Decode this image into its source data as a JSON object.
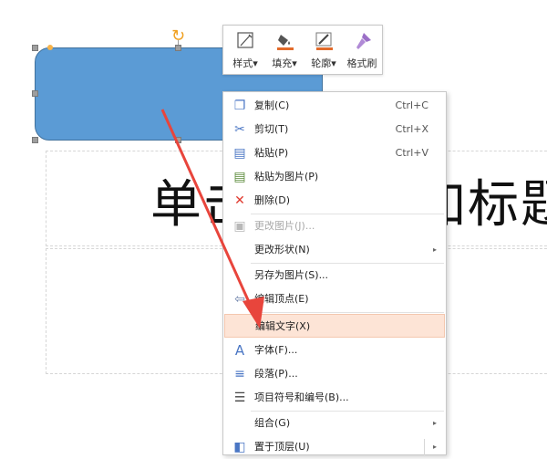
{
  "slide": {
    "title": "单击此处添加标题",
    "title_visible": "单击                 加标题",
    "subtitle_fragment": "题"
  },
  "mini_toolbar": {
    "items": [
      {
        "label": "样式",
        "icon": "shape-style-icon"
      },
      {
        "label": "填充",
        "icon": "fill-bucket-icon"
      },
      {
        "label": "轮廓",
        "icon": "outline-pen-icon"
      },
      {
        "label": "格式刷",
        "icon": "format-brush-icon"
      }
    ],
    "dropdown_glyph": "▾"
  },
  "context_menu": {
    "items": [
      {
        "label": "复制(C)",
        "shortcut": "Ctrl+C",
        "icon": "copy-icon"
      },
      {
        "label": "剪切(T)",
        "shortcut": "Ctrl+X",
        "icon": "cut-icon"
      },
      {
        "label": "粘贴(P)",
        "shortcut": "Ctrl+V",
        "icon": "paste-icon"
      },
      {
        "label": "粘贴为图片(P)",
        "shortcut": "",
        "icon": "paste-as-picture-icon"
      },
      {
        "label": "删除(D)",
        "shortcut": "",
        "icon": "delete-icon"
      },
      {
        "label": "更改图片(J)...",
        "shortcut": "",
        "icon": "change-picture-icon",
        "disabled": true
      },
      {
        "label": "更改形状(N)",
        "shortcut": "",
        "icon": "",
        "submenu": true
      },
      {
        "label": "另存为图片(S)...",
        "shortcut": "",
        "icon": ""
      },
      {
        "label": "编辑顶点(E)",
        "shortcut": "",
        "icon": "edit-points-icon"
      },
      {
        "label": "编辑文字(X)",
        "shortcut": "",
        "icon": "",
        "highlighted": true
      },
      {
        "label": "字体(F)...",
        "shortcut": "",
        "icon": "font-icon"
      },
      {
        "label": "段落(P)...",
        "shortcut": "",
        "icon": "paragraph-icon"
      },
      {
        "label": "项目符号和编号(B)...",
        "shortcut": "",
        "icon": "bullets-icon"
      },
      {
        "label": "组合(G)",
        "shortcut": "",
        "icon": "",
        "submenu": true
      },
      {
        "label": "置于顶层(U)",
        "shortcut": "",
        "icon": "bring-to-front-icon",
        "submenu_split": true
      }
    ],
    "submenu_arrow": "▸"
  },
  "colors": {
    "shape_fill": "#5b9bd5",
    "shape_border": "#41719c",
    "highlight": "#fde4d6",
    "annotation_arrow": "#e8453c",
    "icon_blue": "#4a76c4",
    "delete_red": "#e03a2f"
  }
}
